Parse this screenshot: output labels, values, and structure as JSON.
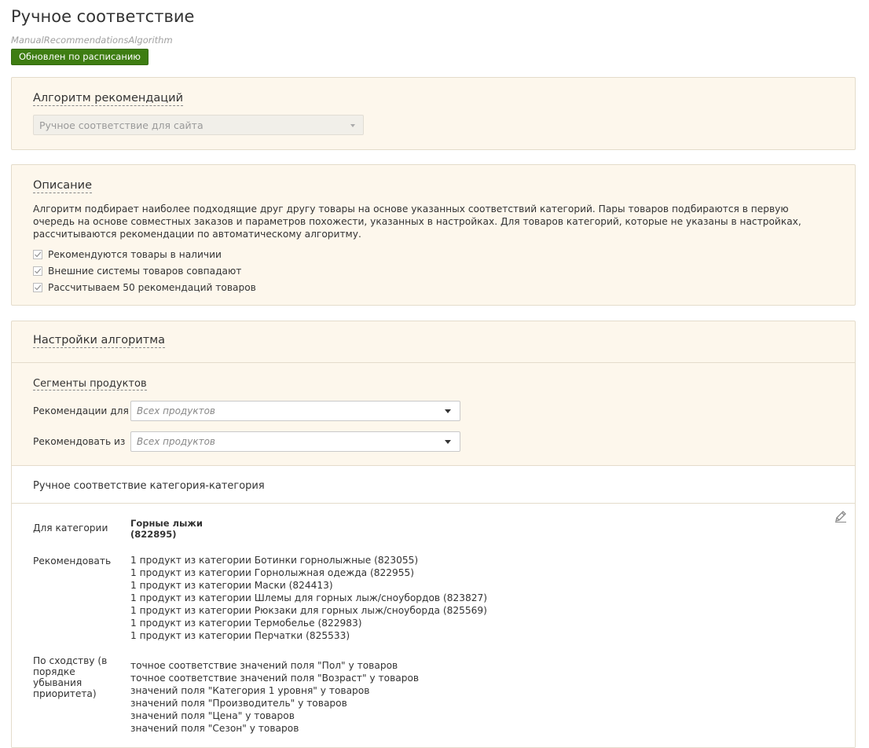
{
  "header": {
    "title": "Ручное соответствие",
    "subtitle": "ManualRecommendationsAlgorithm",
    "status_badge": "Обновлен по расписанию"
  },
  "algorithm_panel": {
    "title": "Алгоритм рекомендаций",
    "select_value": "Ручное соответствие для сайта"
  },
  "description_panel": {
    "title": "Описание",
    "text": "Алгоритм подбирает наиболее подходящие друг другу товары на основе указанных соответствий категорий. Пары товаров подбираются в первую очередь на основе совместных заказов и параметров похожести, указанных в настройках. Для товаров категорий, которые не указаны в настройках, рассчитываются рекомендации по автоматическому алгоритму.",
    "checks": [
      {
        "label": "Рекомендуются товары в наличии",
        "checked": true
      },
      {
        "label": "Внешние системы товаров совпадают",
        "checked": true
      },
      {
        "label": "Рассчитываем 50 рекомендаций товаров",
        "checked": true
      }
    ]
  },
  "settings_panel": {
    "title": "Настройки алгоритма",
    "segments": {
      "title": "Сегменты продуктов",
      "recommend_for_label": "Рекомендации для",
      "recommend_for_value": "Всех продуктов",
      "recommend_from_label": "Рекомендовать из",
      "recommend_from_value": "Всех продуктов"
    },
    "manual_match": {
      "title": "Ручное соответствие категория-категория",
      "for_category_label": "Для категории",
      "category_name": "Горные лыжи",
      "category_id": "(822895)",
      "recommend_label": "Рекомендовать",
      "recommend_items": [
        "1 продукт из категории Ботинки горнолыжные (823055)",
        "1 продукт из категории Горнолыжная одежда (822955)",
        "1 продукт из категории Маски (824413)",
        "1 продукт из категории Шлемы для горных лыж/сноубордов (823827)",
        "1 продукт из категории Рюкзаки для горных лыж/сноуборда (825569)",
        "1 продукт из категории Термобелье (822983)",
        "1 продукт из категории Перчатки (825533)"
      ],
      "similarity_label": "По сходству (в порядке убывания приоритета)",
      "similarity_items": [
        "точное соответствие значений поля \"Пол\" у товаров",
        "точное соответствие значений поля \"Возраст\" у товаров",
        "значений поля \"Категория 1 уровня\" у товаров",
        "значений поля \"Производитель\" у товаров",
        "значений поля \"Цена\" у товаров",
        "значений поля \"Сезон\" у товаров"
      ]
    }
  },
  "colors": {
    "badge_bg": "#3e7d12",
    "panel_bg": "#fdf7ec"
  }
}
